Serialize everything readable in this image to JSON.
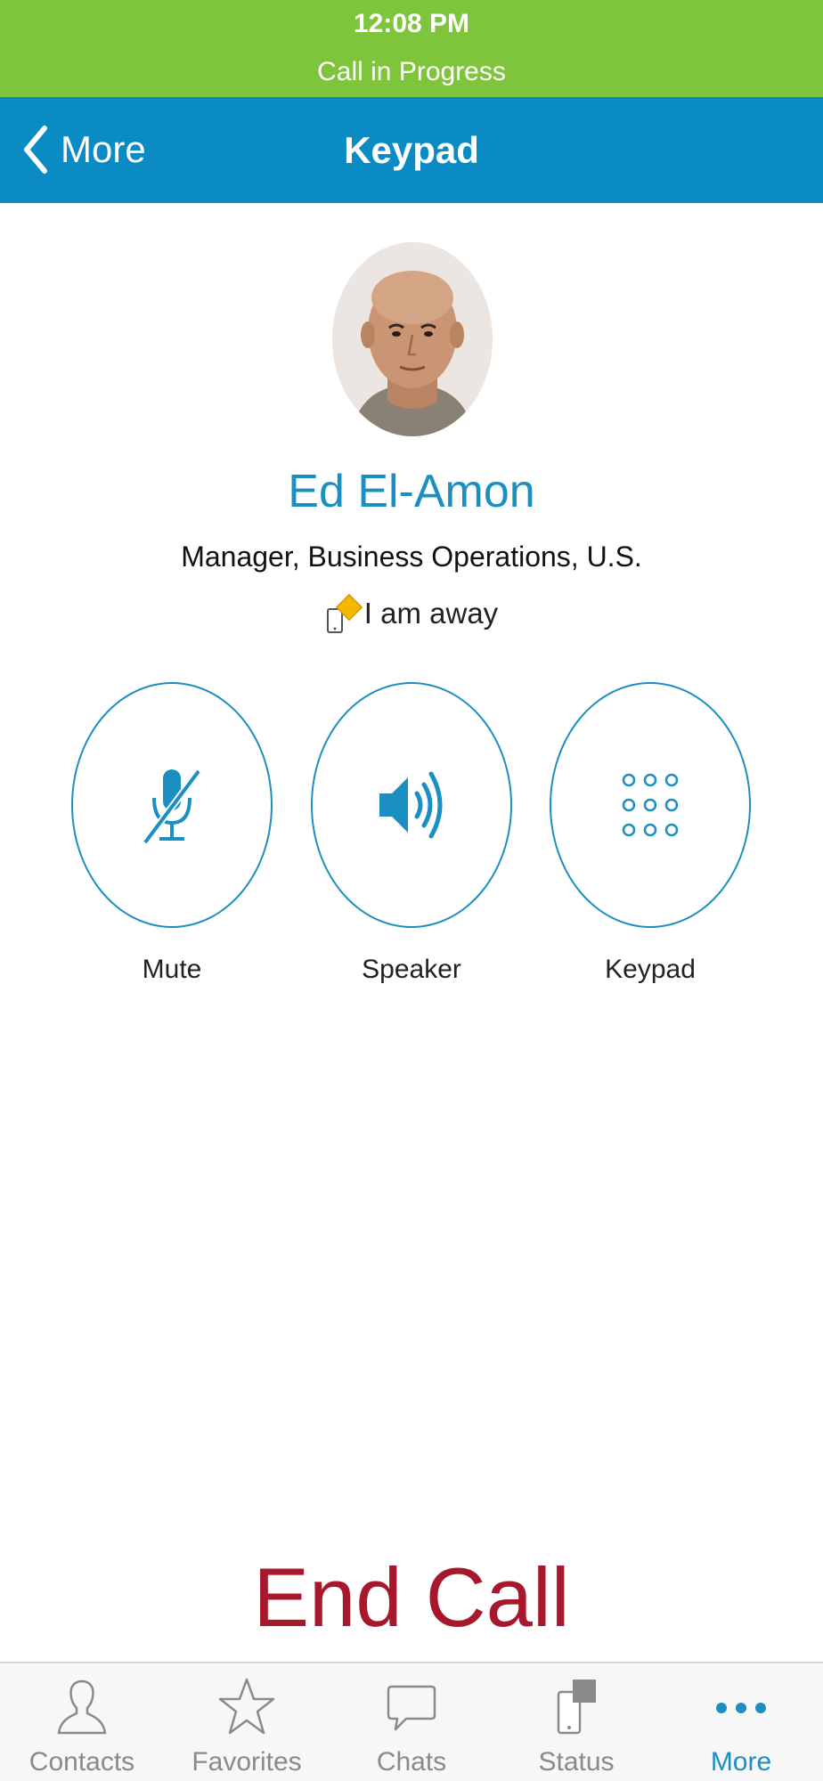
{
  "status": {
    "time": "12:08 PM",
    "call_status": "Call in Progress"
  },
  "nav": {
    "back_label": "More",
    "title": "Keypad"
  },
  "contact": {
    "name": "Ed El-Amon",
    "title": "Manager, Business Operations, U.S.",
    "presence": "I am away"
  },
  "controls": {
    "mute": "Mute",
    "speaker": "Speaker",
    "keypad": "Keypad"
  },
  "end_call": "End Call",
  "tabs": [
    {
      "label": "Contacts",
      "icon": "contacts-icon"
    },
    {
      "label": "Favorites",
      "icon": "star-icon"
    },
    {
      "label": "Chats",
      "icon": "chat-icon"
    },
    {
      "label": "Status",
      "icon": "status-icon"
    },
    {
      "label": "More",
      "icon": "more-icon",
      "active": true
    }
  ],
  "colors": {
    "status_bar": "#7ec53c",
    "nav_bar": "#0b8bc4",
    "accent": "#1b8fc2",
    "end_call": "#a8182c"
  }
}
